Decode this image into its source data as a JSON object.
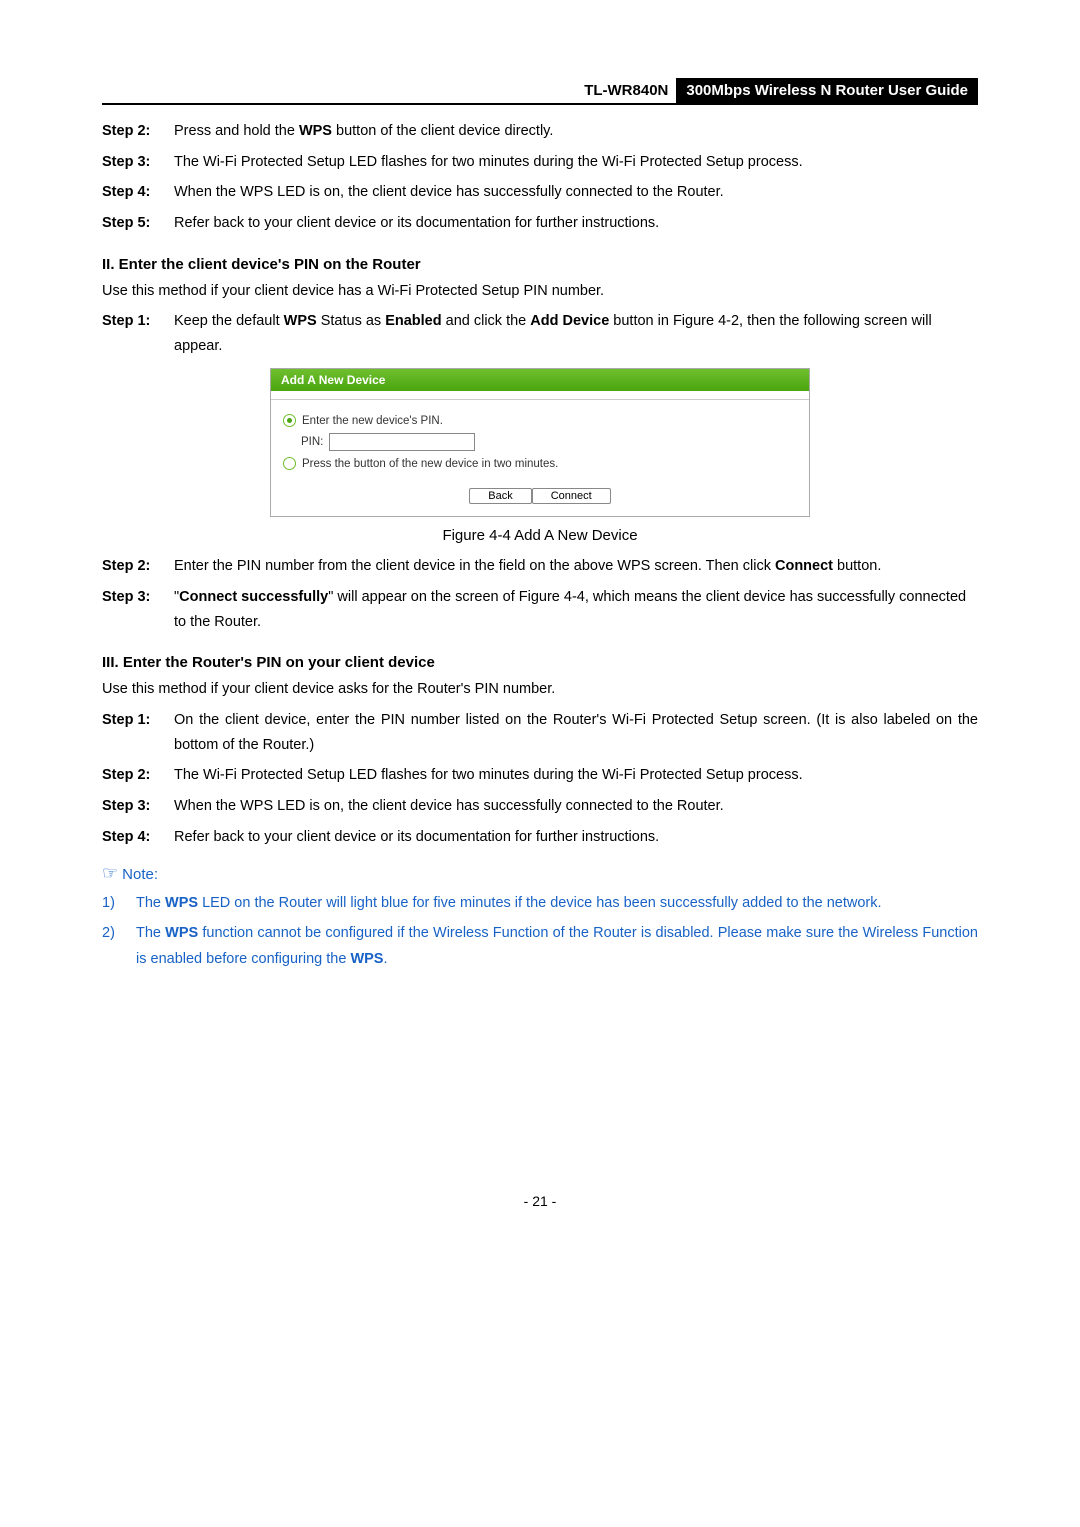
{
  "header": {
    "model": "TL-WR840N",
    "title": "300Mbps Wireless N Router User Guide"
  },
  "section1_steps": {
    "s2_label": "Step 2:",
    "s2_prefix": "Press and hold the ",
    "s2_bold": "WPS",
    "s2_suffix": " button of the client device directly.",
    "s3_label": "Step 3:",
    "s3_text": "The Wi-Fi Protected Setup LED flashes for two minutes during the Wi-Fi Protected Setup process.",
    "s4_label": "Step 4:",
    "s4_text": "When the WPS LED is on, the client device has successfully connected to the Router.",
    "s5_label": "Step 5:",
    "s5_text": "Refer back to your client device or its documentation for further instructions."
  },
  "section2": {
    "head": "II.   Enter the client device's PIN on the Router",
    "intro": "Use this method if your client device has a Wi-Fi Protected Setup PIN number.",
    "s1_label": "Step 1:",
    "s1_a": "Keep the default ",
    "s1_b": "WPS",
    "s1_c": " Status as ",
    "s1_d": "Enabled",
    "s1_e": " and click the ",
    "s1_f": "Add Device",
    "s1_g": " button in Figure 4-2, then the following screen will appear."
  },
  "panel": {
    "title": "Add A New Device",
    "opt1": "Enter the new device's PIN.",
    "pin_label": "PIN:",
    "pin_value": "",
    "opt2": "Press the button of the new device in two minutes.",
    "back": "Back",
    "connect": "Connect"
  },
  "fig_caption": "Figure 4-4    Add A New Device",
  "section2b": {
    "s2_label": "Step 2:",
    "s2_a": "Enter the PIN number from the client device in the field on the above WPS screen. Then click ",
    "s2_b": "Connect",
    "s2_c": " button.",
    "s3_label": "Step 3:",
    "s3_a": "\"",
    "s3_b": "Connect successfully",
    "s3_c": "\" will appear on the screen of Figure 4-4, which means the client device has successfully connected to the Router."
  },
  "section3": {
    "head": "III.  Enter the Router's PIN on your client device",
    "intro": "Use this method if your client device asks for the Router's PIN number.",
    "s1_label": "Step 1:",
    "s1_text": "On the client device, enter the PIN number listed on the Router's Wi-Fi Protected Setup screen. (It is also labeled on the bottom of the Router.)",
    "s2_label": "Step 2:",
    "s2_text": "The Wi-Fi Protected Setup LED flashes for two minutes during the Wi-Fi Protected Setup process.",
    "s3_label": "Step 3:",
    "s3_text": "When the WPS LED is on, the client device has successfully connected to the Router.",
    "s4_label": "Step 4:",
    "s4_text": "Refer back to your client device or its documentation for further instructions."
  },
  "note": {
    "head": "Note:",
    "n1_num": "1)",
    "n1_a": "The ",
    "n1_b": "WPS",
    "n1_c": " LED on the Router will light blue for five minutes if the device has been successfully added to the network.",
    "n2_num": "2)",
    "n2_a": "The ",
    "n2_b": "WPS",
    "n2_c": " function cannot be configured if the Wireless Function of the Router is disabled. Please make sure the Wireless Function is enabled before configuring the ",
    "n2_d": "WPS",
    "n2_e": "."
  },
  "footer": "- 21 -"
}
